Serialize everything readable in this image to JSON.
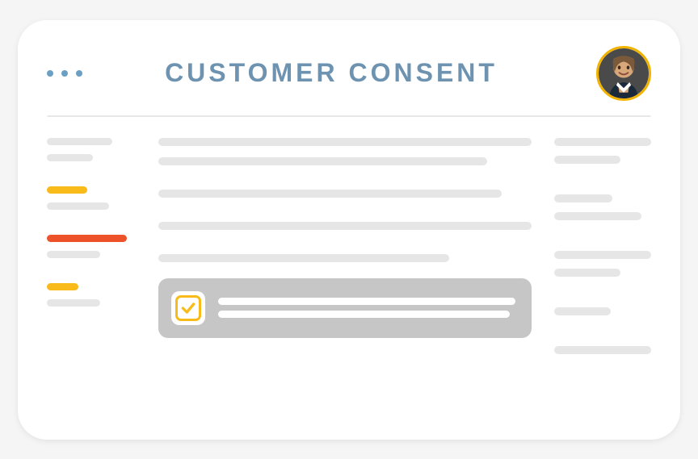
{
  "header": {
    "title": "CUSTOMER CONSENT"
  },
  "colors": {
    "accent_yellow": "#f9bb19",
    "accent_red": "#ee5228",
    "title_blue": "#6d93b0",
    "dot_blue": "#6b9fc4",
    "placeholder_gray": "#e6e6e6",
    "consent_box_gray": "#c6c6c6"
  }
}
